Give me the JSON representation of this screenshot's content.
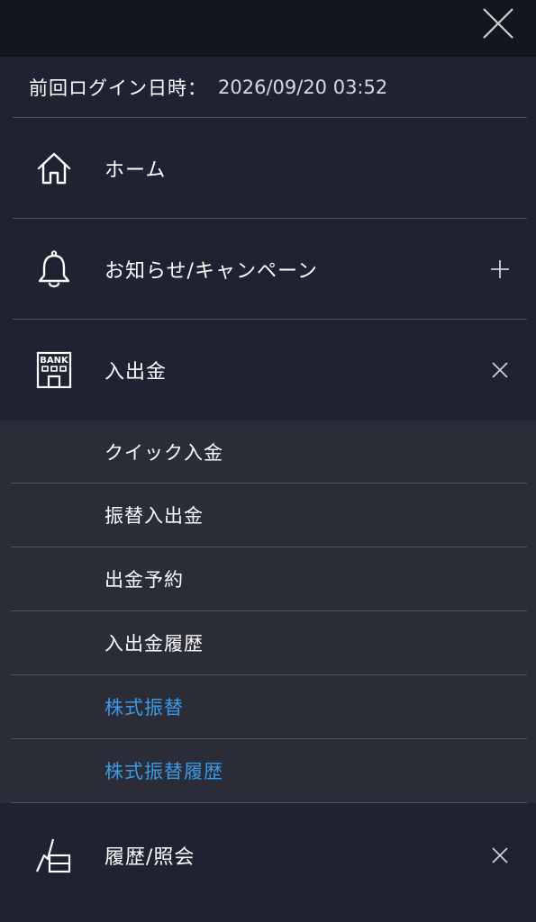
{
  "login": {
    "label": "前回ログイン日時：",
    "value": "2026/09/20 03:52"
  },
  "menu": {
    "home": {
      "label": "ホーム",
      "icon": "home-icon"
    },
    "news": {
      "label": "お知らせ/キャンペーン",
      "icon": "bell-icon",
      "toggle": "plus-icon"
    },
    "deposit": {
      "label": "入出金",
      "icon": "bank-icon",
      "icon_text": "BANK",
      "toggle": "close-icon"
    },
    "history": {
      "label": "履歴/照会",
      "icon": "chart-icon",
      "toggle": "close-icon"
    }
  },
  "submenu": [
    {
      "label": "クイック入金",
      "color": "#ffffff"
    },
    {
      "label": "振替入出金",
      "color": "#ffffff"
    },
    {
      "label": "出金予約",
      "color": "#ffffff"
    },
    {
      "label": "入出金履歴",
      "color": "#ffffff"
    },
    {
      "label": "株式振替",
      "color": "#3b9be8"
    },
    {
      "label": "株式振替履歴",
      "color": "#3b9be8"
    }
  ],
  "colors": {
    "background": "#1f2230",
    "topbar": "#14161d",
    "submenu_bg": "#2a2c37",
    "divider": "#4e5261",
    "link_blue": "#3b9be8"
  }
}
